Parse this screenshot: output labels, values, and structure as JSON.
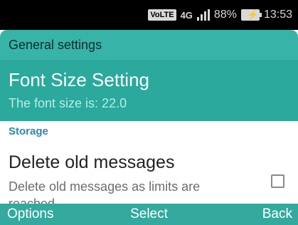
{
  "status": {
    "volte": "VoLTE",
    "network": "4G",
    "battery": "88%",
    "time": "13:53"
  },
  "header": {
    "title": "General settings"
  },
  "selected_item": {
    "title": "Font Size Setting",
    "summary": "The font size is: 22.0"
  },
  "section": {
    "label": "Storage"
  },
  "delete_item": {
    "title": "Delete old messages",
    "summary": "Delete old messages as limits are reached",
    "checked": false
  },
  "softkeys": {
    "left": "Options",
    "center": "Select",
    "right": "Back"
  }
}
